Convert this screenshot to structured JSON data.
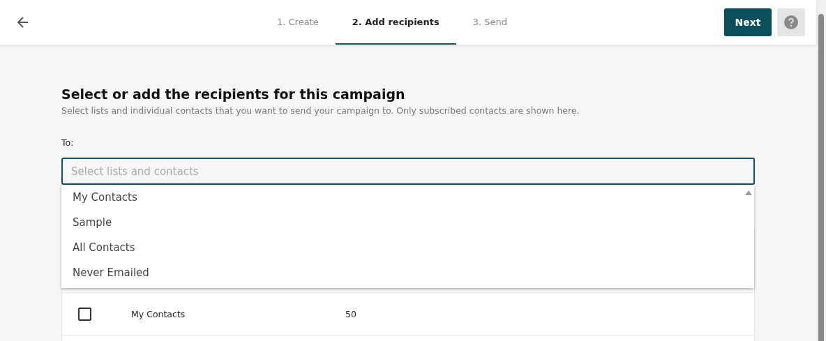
{
  "header": {
    "steps": [
      {
        "label": "1. Create",
        "selected": false
      },
      {
        "label": "2. Add recipients",
        "selected": true
      },
      {
        "label": "3. Send",
        "selected": false
      }
    ],
    "next_button": "Next"
  },
  "heading": "Select or add the recipients for this campaign",
  "subheading": "Select lists and individual contacts that you want to send your campaign to. Only subscribed contacts are shown here.",
  "to_label": "To:",
  "field": {
    "placeholder": "Select lists and contacts"
  },
  "dropdown": {
    "options": [
      "My Contacts",
      "Sample",
      "All Contacts",
      "Never Emailed"
    ]
  },
  "table": {
    "rows": [
      {
        "name": "My Contacts",
        "count": "50",
        "checked": false
      }
    ]
  }
}
